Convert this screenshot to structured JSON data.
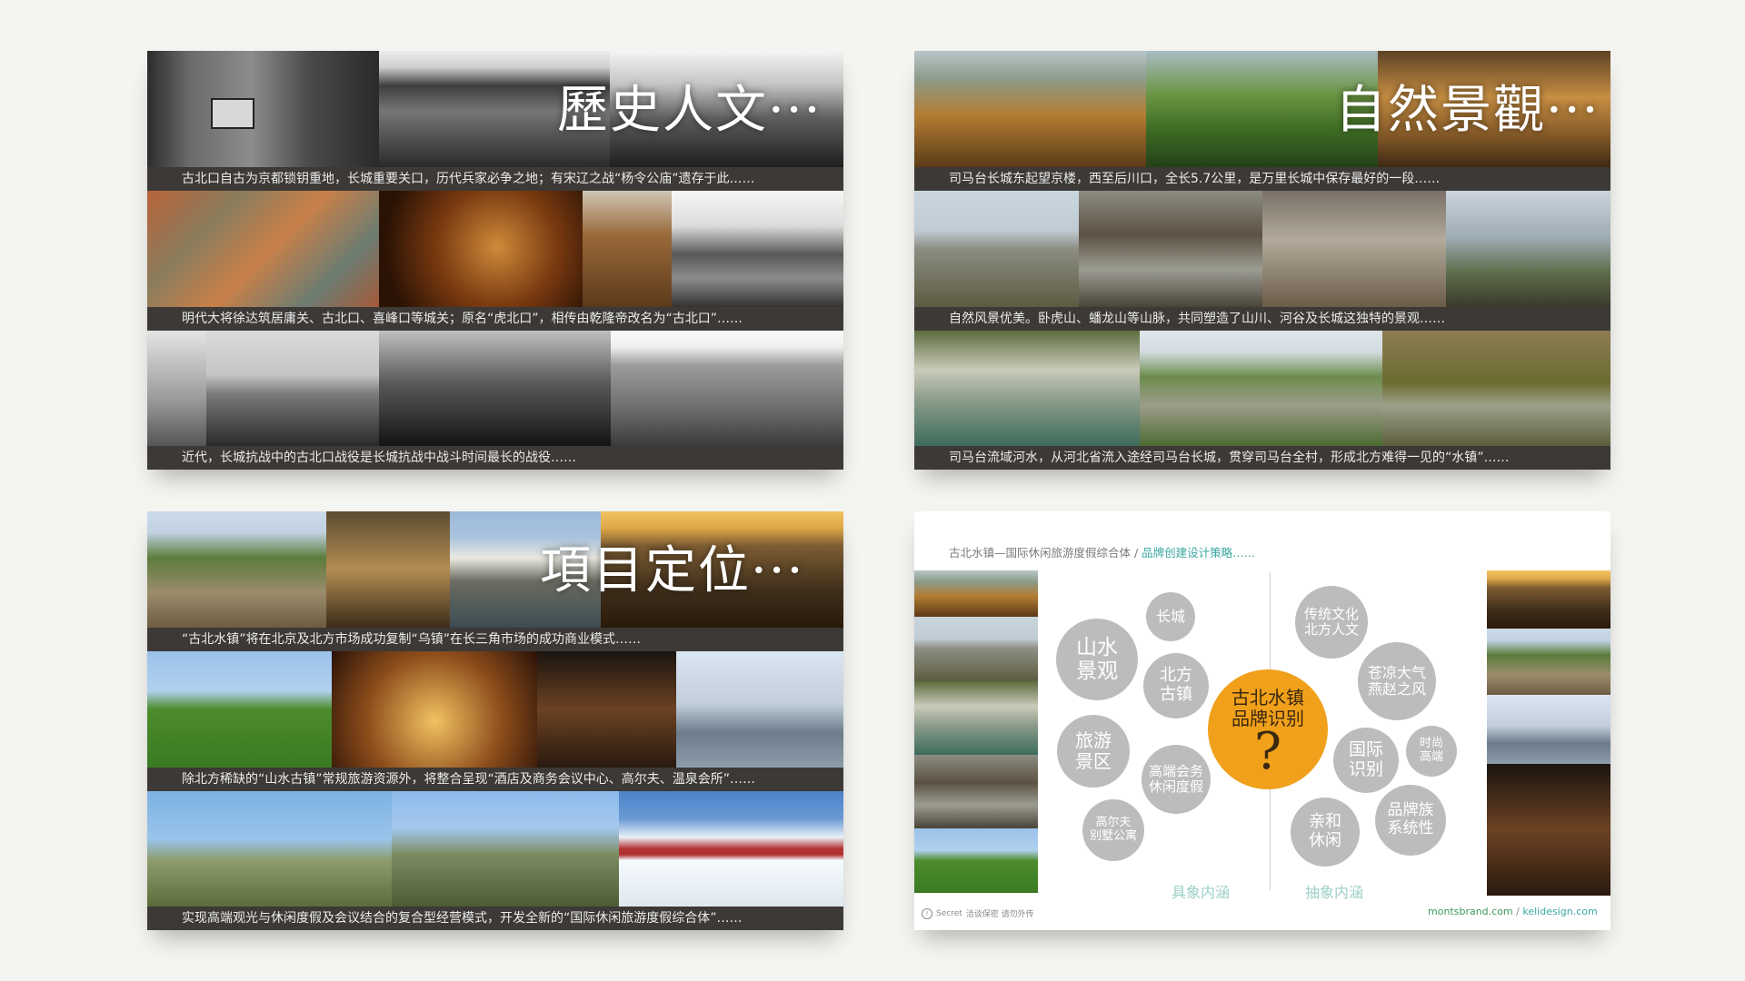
{
  "panels": {
    "history": {
      "title": "歷史人文···",
      "captions": [
        "古北口自古为京都锁钥重地，长城重要关口，历代兵家必争之地；有宋辽之战“杨令公庙”遗存于此……",
        "明代大将徐达筑居庸关、古北口、喜峰口等城关；原名“虎北口”，相传由乾隆帝改名为“古北口”……",
        "近代，长城抗战中的古北口战役是长城抗战中战斗时间最长的战役……"
      ]
    },
    "nature": {
      "title": "自然景觀···",
      "captions": [
        "司马台长城东起望京楼，西至后川口，全长5.7公里，是万里长城中保存最好的一段……",
        "自然风景优美。卧虎山、蟠龙山等山脉，共同塑造了山川、河谷及长城这独特的景观……",
        "司马台流域河水，从河北省流入途经司马台长城，贯穿司马台全村，形成北方难得一见的“水镇”……"
      ]
    },
    "positioning": {
      "title": "項目定位···",
      "captions": [
        "“古北水镇”将在北京及北方市场成功复制“乌镇”在长三角市场的成功商业模式……",
        "除北方稀缺的“山水古镇”常规旅游资源外，将整合呈现“酒店及商务会议中心、高尔夫、温泉会所”……",
        "实现高端观光与休闲度假及会议结合的复合型经营模式，开发全新的“国际休闲旅游度假综合体”……"
      ]
    },
    "brand": {
      "header_main": "古北水镇—国际休闲旅游度假综合体 / ",
      "header_accent": "品牌创建设计策略……",
      "center": {
        "label": "古北水镇\n品牌识别",
        "mark": "?"
      },
      "concrete": {
        "label": "具象内涵",
        "items": [
          "山水\n景观",
          "长城",
          "北方\n古镇",
          "旅游\n景区",
          "高端会务\n休闲度假",
          "高尔夫\n别墅公寓"
        ]
      },
      "abstract": {
        "label": "抽象内涵",
        "items": [
          "传统文化\n北方人文",
          "苍凉大气\n燕赵之风",
          "国际\n识别",
          "时尚\n高端",
          "品牌族\n系统性",
          "亲和\n休闲"
        ]
      },
      "footer": {
        "secret": "Secret",
        "note": "洽谈保密 请勿外传",
        "site1": "montsbrand.com",
        "separator": " / ",
        "site2": "kelidesign.com"
      }
    }
  },
  "colors": {
    "background": "#f4f4f0",
    "caption_bar": "#3c3936",
    "accent_orange": "#f0a01a",
    "circle_gray": "#bcbcbc",
    "teal": "#3aa7a0",
    "green": "#3a9a5a"
  }
}
